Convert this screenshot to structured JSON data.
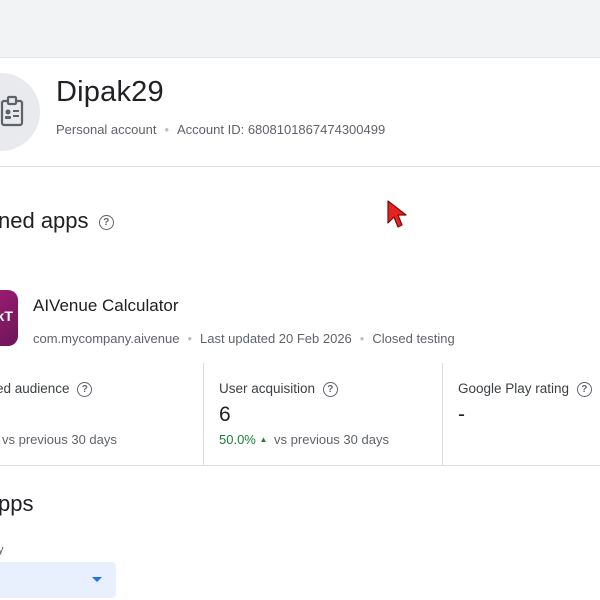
{
  "developer": {
    "name": "Dipak29",
    "account_type": "Personal account",
    "account_id": "Account ID: 6808101867474300499"
  },
  "pinned_apps": {
    "title": "ned apps"
  },
  "app": {
    "icon_text": "okT",
    "name": "AIVenue Calculator",
    "package": "com.mycompany.aivenue",
    "last_updated": "Last updated 20 Feb 2026",
    "status": "Closed testing"
  },
  "stats": {
    "audience": {
      "label": "ed audience",
      "sub": "vs previous 30 days"
    },
    "acquisition": {
      "label": "User acquisition",
      "value": "6",
      "change": "50.0%",
      "sub": "vs previous 30 days"
    },
    "rating": {
      "label": "Google Play rating",
      "value": "-"
    }
  },
  "all_apps": {
    "title": "pps",
    "filter_label": "y"
  },
  "icons": {
    "help": "?",
    "trend_up": "▲"
  },
  "colors": {
    "trend_positive": "#188038",
    "accent": "#1a73e8",
    "app_icon": "#a01d75"
  }
}
